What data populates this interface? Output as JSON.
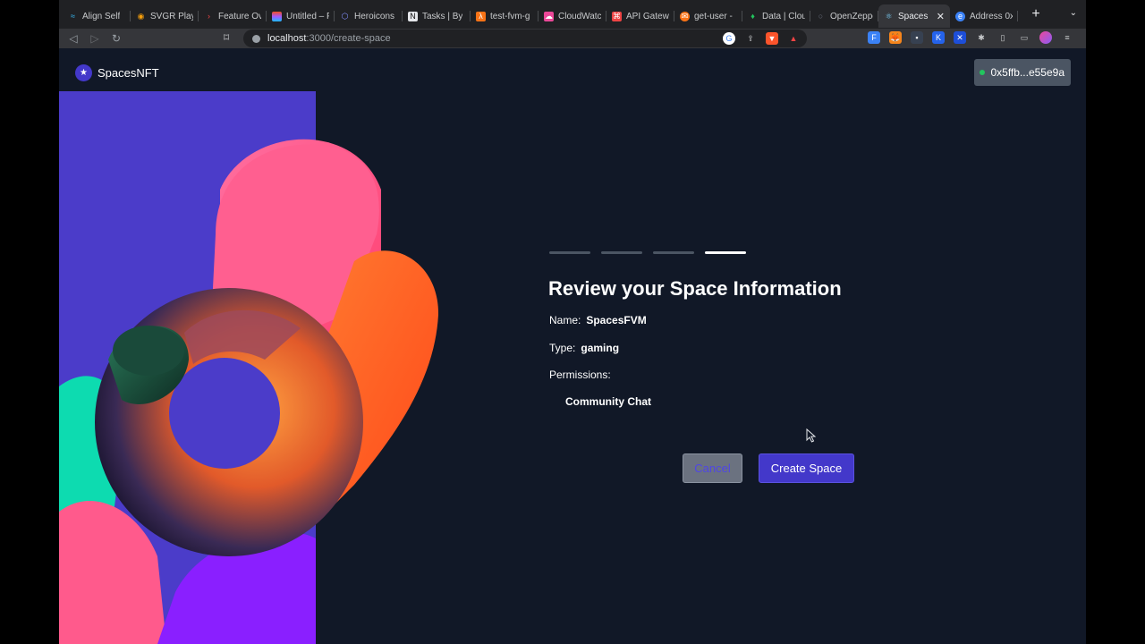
{
  "browser": {
    "tabs": [
      {
        "label": "Align Self",
        "icon": "tailwind-icon",
        "color": "#38bdf8"
      },
      {
        "label": "SVGR Playg",
        "icon": "eye-icon",
        "color": "#f59e0b"
      },
      {
        "label": "Feature Ov",
        "icon": "chevron-icon",
        "color": "#ef4444"
      },
      {
        "label": "Untitled – F",
        "icon": "figma-icon",
        "color": "#a855f7"
      },
      {
        "label": "Heroicons",
        "icon": "shield-icon",
        "color": "#818cf8"
      },
      {
        "label": "Tasks | By",
        "icon": "notion-icon",
        "color": "#e5e7eb"
      },
      {
        "label": "test-fvm-g",
        "icon": "lambda-icon",
        "color": "#f97316"
      },
      {
        "label": "CloudWatc",
        "icon": "cloudwatch-icon",
        "color": "#ec4899"
      },
      {
        "label": "API Gatewa",
        "icon": "api-gateway-icon",
        "color": "#ef4444"
      },
      {
        "label": "get-user -",
        "icon": "postman-icon",
        "color": "#f97316"
      },
      {
        "label": "Data | Clou",
        "icon": "leaf-icon",
        "color": "#22c55e"
      },
      {
        "label": "OpenZeppe",
        "icon": "circle-icon",
        "color": "#6b7280"
      }
    ],
    "active_tab": {
      "label": "Spaces",
      "icon": "react-icon",
      "color": "#7dd3fc"
    },
    "after_tab": {
      "label": "Address 0x",
      "icon": "etherscan-icon",
      "color": "#3b82f6"
    },
    "url_host": "localhost",
    "url_path": ":3000/create-space"
  },
  "app": {
    "brand": "SpacesNFT",
    "wallet_address": "0x5ffb...e55e9a"
  },
  "review": {
    "title": "Review your Space Information",
    "name_label": "Name:",
    "name_value": "SpacesFVM",
    "type_label": "Type:",
    "type_value": "gaming",
    "permissions_label": "Permissions:",
    "permissions": [
      "Community Chat"
    ],
    "steps_total": 4,
    "current_step": 4
  },
  "actions": {
    "cancel_label": "Cancel",
    "create_label": "Create Space"
  },
  "colors": {
    "background": "#111827",
    "primary": "#4338ca",
    "cancel_bg": "#6b7280",
    "wallet_status": "#22c55e"
  }
}
